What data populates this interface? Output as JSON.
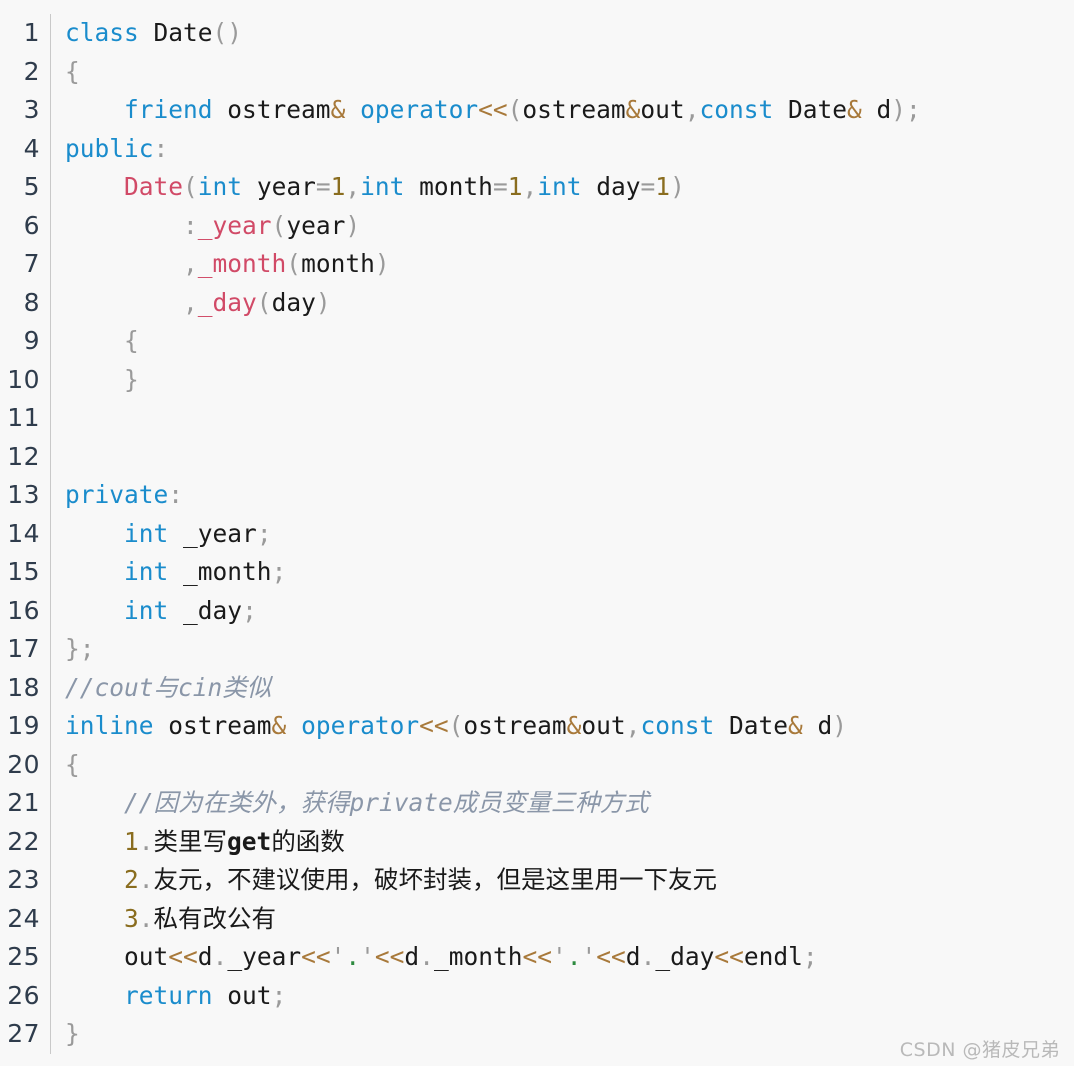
{
  "editor": {
    "language": "cpp",
    "background_color": "#f8f8f8",
    "gutter_color": "#2f3c4c",
    "first_line": 1,
    "last_line": 27,
    "total_lines": 27
  },
  "theme": {
    "keyword": "#1a8ccc",
    "identifier": "#1a1a1a",
    "punctuation": "#9a9a9a",
    "operator": "#a8793a",
    "number": "#8a6d1f",
    "type_member": "#d14a67",
    "string": "#2e8b40",
    "comment": "#8a96a8"
  },
  "watermark": {
    "text": "CSDN @猪皮兄弟"
  },
  "lines": [
    {
      "n": "1",
      "text": "class Date()"
    },
    {
      "n": "2",
      "text": "{"
    },
    {
      "n": "3",
      "text": "    friend ostream& operator<<(ostream&out,const Date& d);"
    },
    {
      "n": "4",
      "text": "public:"
    },
    {
      "n": "5",
      "text": "    Date(int year=1,int month=1,int day=1)"
    },
    {
      "n": "6",
      "text": "        :_year(year)"
    },
    {
      "n": "7",
      "text": "        ,_month(month)"
    },
    {
      "n": "8",
      "text": "        ,_day(day)"
    },
    {
      "n": "9",
      "text": "    {"
    },
    {
      "n": "10",
      "text": "    }"
    },
    {
      "n": "11",
      "text": ""
    },
    {
      "n": "12",
      "text": ""
    },
    {
      "n": "13",
      "text": "private:"
    },
    {
      "n": "14",
      "text": "    int _year;"
    },
    {
      "n": "15",
      "text": "    int _month;"
    },
    {
      "n": "16",
      "text": "    int _day;"
    },
    {
      "n": "17",
      "text": "};"
    },
    {
      "n": "18",
      "text": "//cout与cin类似"
    },
    {
      "n": "19",
      "text": "inline ostream& operator<<(ostream&out,const Date& d)"
    },
    {
      "n": "20",
      "text": "{"
    },
    {
      "n": "21",
      "text": "    //因为在类外，获得private成员变量三种方式"
    },
    {
      "n": "22",
      "text": "    1.类里写get的函数"
    },
    {
      "n": "23",
      "text": "    2.友元，不建议使用，破坏封装，但是这里用一下友元"
    },
    {
      "n": "24",
      "text": "    3.私有改公有"
    },
    {
      "n": "25",
      "text": "    out<<d._year<<'.'<<d._month<<'.'<<d._day<<endl;"
    },
    {
      "n": "26",
      "text": "    return out;"
    },
    {
      "n": "27",
      "text": "}"
    }
  ],
  "line_numbers": [
    "1",
    "2",
    "3",
    "4",
    "5",
    "6",
    "7",
    "8",
    "9",
    "10",
    "11",
    "12",
    "13",
    "14",
    "15",
    "16",
    "17",
    "18",
    "19",
    "20",
    "21",
    "22",
    "23",
    "24",
    "25",
    "26",
    "27"
  ]
}
